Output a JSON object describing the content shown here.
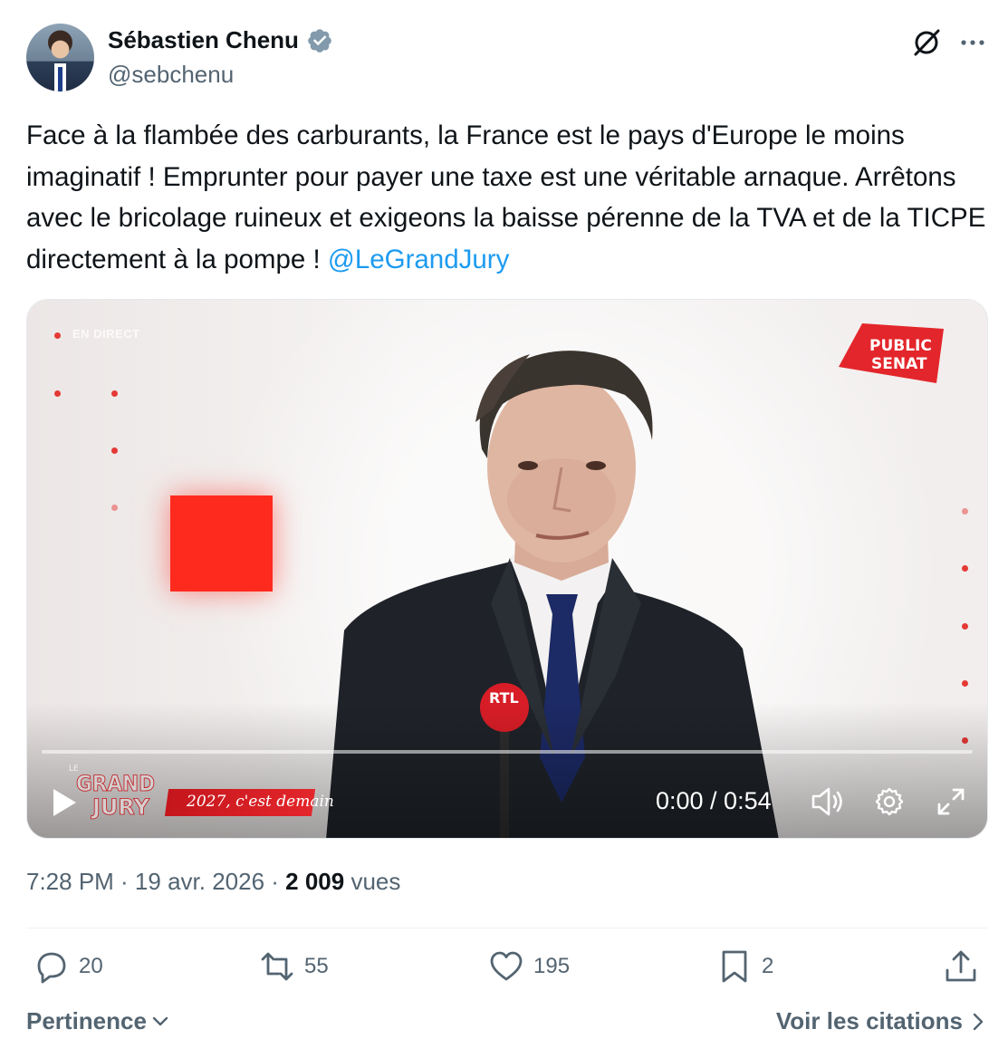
{
  "author": {
    "name": "Sébastien Chenu",
    "handle": "@sebchenu",
    "verified_color": "#829aab"
  },
  "tweet": {
    "text": "Face à la flambée des carburants, la France est le pays d'Europe le moins imaginatif ! Emprunter pour payer une taxe est une véritable arnaque. Arrêtons avec le bricolage ruineux et exigeons la baisse pérenne de la TVA et de la TICPE directement à la pompe ! ",
    "mention": "@LeGrandJury",
    "mention_color": "#1d9bf0"
  },
  "video": {
    "live_label": "EN DIRECT",
    "channel_logo_line1": "PUBLIC",
    "channel_logo_line2": "SENAT",
    "mic_logo": "RTL",
    "show_logo_small": "LE",
    "show_logo_line1": "GRAND",
    "show_logo_line2": "JURY",
    "banner_text": "2027, c'est demain",
    "time": "0:00 / 0:54",
    "progress": 0
  },
  "meta": {
    "time": "7:28 PM · 19 avr. 2026 · ",
    "views": "2 009",
    "views_label": " vues"
  },
  "actions": {
    "replies": "20",
    "reposts": "55",
    "likes": "195",
    "bookmarks": "2"
  },
  "footer": {
    "sort_label": "Pertinence",
    "quotes_label": "Voir les citations"
  }
}
